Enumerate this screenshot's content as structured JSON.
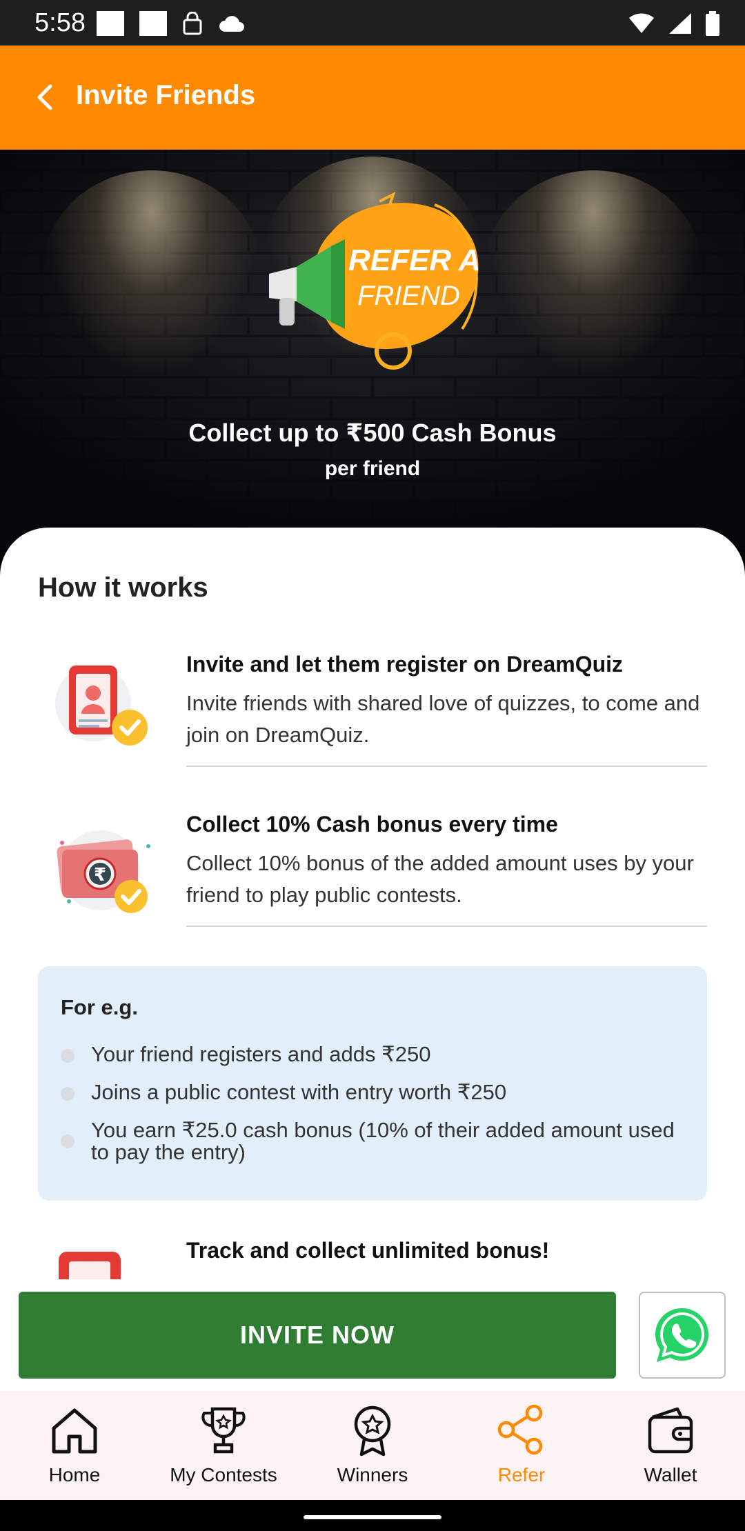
{
  "status_bar": {
    "time": "5:58"
  },
  "app_bar": {
    "title": "Invite Friends"
  },
  "hero": {
    "logo_text_line1": "REFER A",
    "logo_text_line2": "FRIEND",
    "headline": "Collect up to ₹500 Cash Bonus",
    "subheadline": "per friend"
  },
  "how_it_works": {
    "title": "How it works",
    "steps": [
      {
        "title": "Invite and let them register on DreamQuiz",
        "description": "Invite friends with shared love of quizzes, to come and join on DreamQuiz.",
        "icon": "profile-card-check-icon"
      },
      {
        "title": "Collect 10% Cash bonus every time",
        "description": "Collect 10% bonus of the added amount uses by your friend to play public contests.",
        "icon": "cash-rupee-check-icon"
      },
      {
        "title": "Track and collect unlimited bonus!",
        "description": "",
        "icon": "profile-card-icon"
      }
    ],
    "example": {
      "title": "For e.g.",
      "items": [
        "Your friend registers and adds ₹250",
        "Joins a public contest with entry worth ₹250",
        "You earn ₹25.0 cash bonus (10% of their added amount used to pay the entry)"
      ]
    }
  },
  "actions": {
    "invite_label": "INVITE NOW",
    "whatsapp_icon": "whatsapp-icon"
  },
  "bottom_nav": {
    "items": [
      {
        "label": "Home",
        "icon": "home-icon"
      },
      {
        "label": "My Contests",
        "icon": "trophy-icon"
      },
      {
        "label": "Winners",
        "icon": "medal-icon"
      },
      {
        "label": "Refer",
        "icon": "share-icon",
        "active": true
      },
      {
        "label": "Wallet",
        "icon": "wallet-icon"
      }
    ]
  },
  "colors": {
    "brand_orange": "#ff8a00",
    "invite_green": "#2e7d32",
    "example_bg": "#e2effa",
    "whatsapp_green": "#25d366"
  }
}
